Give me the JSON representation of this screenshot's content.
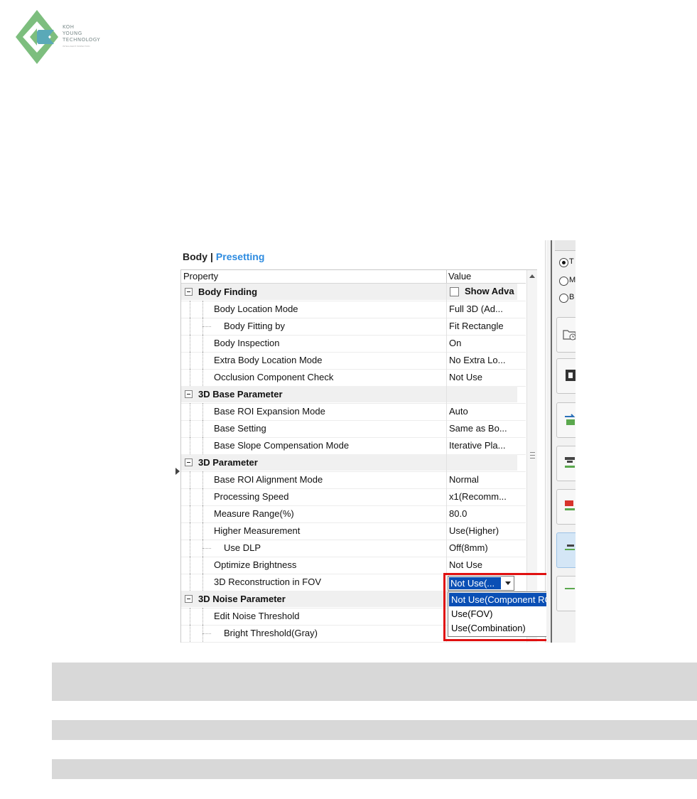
{
  "logo": {
    "lines": [
      "KOH",
      "YOUNG",
      "TECHNOLOGY"
    ],
    "tagline": "INTELLIGENT INSPECTION",
    "colors": {
      "green": "#7dbe7e",
      "blue": "#5aa9b8"
    }
  },
  "panel": {
    "title": "Body",
    "separator": "|",
    "link": "Presetting"
  },
  "grid": {
    "col_property": "Property",
    "col_value": "Value",
    "show_advanced_label": "Show Adva",
    "rows": [
      {
        "type": "category",
        "label": "Body Finding"
      },
      {
        "type": "prop",
        "label": "Body Location Mode",
        "value": "Full 3D (Ad...",
        "level": 1
      },
      {
        "type": "prop",
        "label": "Body Fitting by",
        "value": "Fit Rectangle",
        "level": 2
      },
      {
        "type": "prop",
        "label": "Body Inspection",
        "value": "On",
        "level": 1
      },
      {
        "type": "prop",
        "label": "Extra Body Location Mode",
        "value": "No Extra Lo...",
        "level": 1
      },
      {
        "type": "prop",
        "label": "Occlusion Component Check",
        "value": "Not Use",
        "level": 1
      },
      {
        "type": "category",
        "label": "3D Base Parameter"
      },
      {
        "type": "prop",
        "label": "Base ROI Expansion Mode",
        "value": "Auto",
        "level": 1
      },
      {
        "type": "prop",
        "label": "Base Setting",
        "value": "Same as Bo...",
        "level": 1
      },
      {
        "type": "prop",
        "label": "Base Slope Compensation Mode",
        "value": "Iterative Pla...",
        "level": 1
      },
      {
        "type": "category",
        "label": "3D Parameter"
      },
      {
        "type": "prop",
        "label": "Base ROI Alignment Mode",
        "value": "Normal",
        "level": 1
      },
      {
        "type": "prop",
        "label": "Processing Speed",
        "value": "x1(Recomm...",
        "level": 1
      },
      {
        "type": "prop",
        "label": "Measure Range(%)",
        "value": "80.0",
        "level": 1
      },
      {
        "type": "prop",
        "label": "Higher Measurement",
        "value": "Use(Higher)",
        "level": 1
      },
      {
        "type": "prop",
        "label": "Use DLP",
        "value": "Off(8mm)",
        "level": 2
      },
      {
        "type": "prop",
        "label": "Optimize Brightness",
        "value": "Not Use",
        "level": 1
      },
      {
        "type": "prop",
        "label": "3D Reconstruction in FOV",
        "value": "",
        "level": 1
      },
      {
        "type": "category",
        "label": "3D Noise Parameter"
      },
      {
        "type": "prop",
        "label": "Edit Noise Threshold",
        "value": "",
        "level": 1
      },
      {
        "type": "prop",
        "label": "Bright Threshold(Gray)",
        "value": "",
        "level": 2
      }
    ]
  },
  "combo": {
    "value": "Not Use(...",
    "options": [
      "Not Use(Component ROI)",
      "Use(FOV)",
      "Use(Combination)"
    ],
    "selected_index": 0
  },
  "right_panel": {
    "radios": [
      {
        "label": "T",
        "checked": true
      },
      {
        "label": "M",
        "checked": false
      },
      {
        "label": "B",
        "checked": false
      }
    ],
    "buttons": [
      "folder-clock-icon",
      "body-icon",
      "transfer-icon",
      "stack-icon",
      "out-icon",
      "align-icon"
    ]
  },
  "colors": {
    "link": "#2d8be0",
    "selection": "#0a4fb5",
    "highlight": "#e01010",
    "gray_bar": "#d8d8d8"
  }
}
